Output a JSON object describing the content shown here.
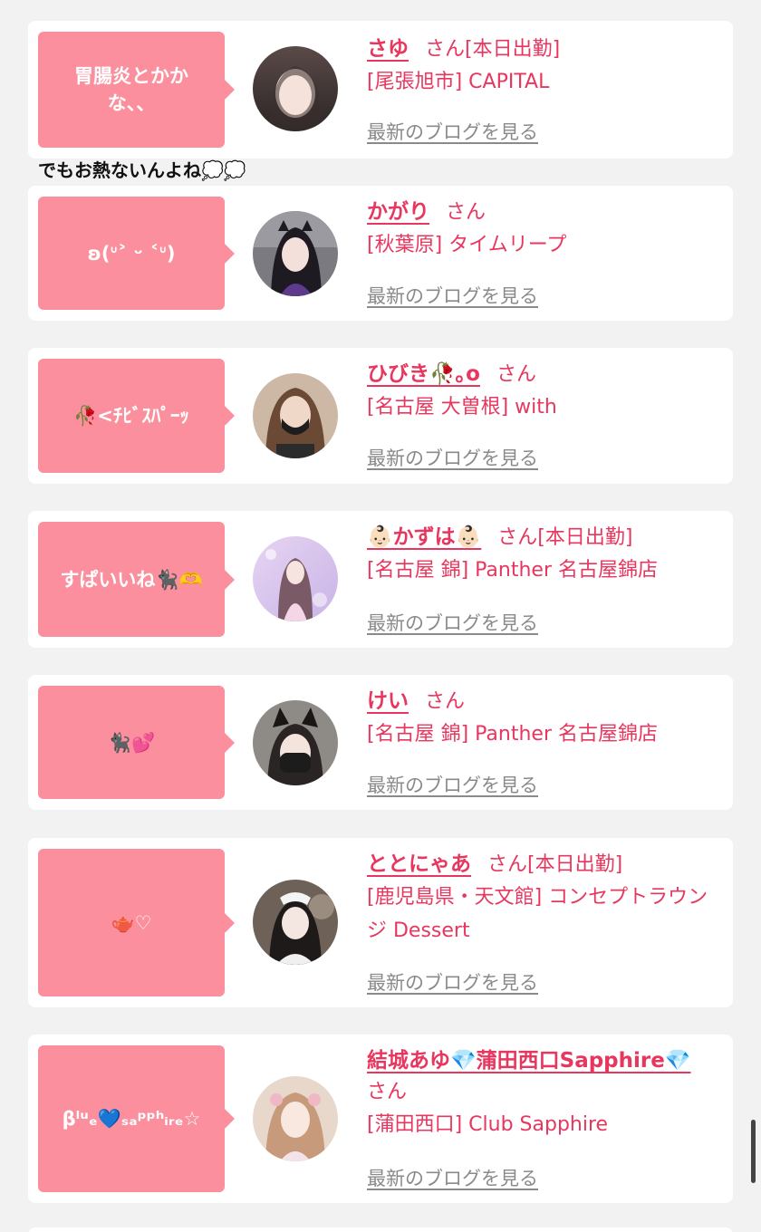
{
  "common": {
    "san": "さん",
    "blog_link": "最新のブログを見る"
  },
  "colors": {
    "page_bg": "#f2f2f2",
    "card_bg": "#ffffff",
    "bubble_bg": "#fb8f9d",
    "accent": "#e8375f",
    "link_gray": "#8a8a8a"
  },
  "overflow_text": "でもお熱ないんよね💭💭",
  "cards": [
    {
      "bubble": "胃腸炎とかかな、、",
      "name": "さゆ",
      "flag": "[本日出勤]",
      "shop": "[尾張旭市] CAPITAL"
    },
    {
      "bubble": "ʚ(ᐡ˃ ᵕ ˂ᐡ)",
      "name": "かがり",
      "flag": "",
      "shop": "[秋葉原] タイムリープ"
    },
    {
      "bubble": "🥀<ﾁﾋﾞｽﾊﾟｰｯ",
      "name": "ひびき🥀｡o",
      "flag": "",
      "shop": "[名古屋 大曽根] with"
    },
    {
      "bubble": "すぱいいね🐈‍⬛🫶",
      "name": "👶🏻かずは👶🏻",
      "flag": "[本日出勤]",
      "shop": "[名古屋 錦] Panther 名古屋錦店"
    },
    {
      "bubble": "🐈‍⬛💕",
      "name": "けい",
      "flag": "",
      "shop": "[名古屋 錦] Panther 名古屋錦店"
    },
    {
      "bubble": "🫖♡",
      "name": "ととにゃあ",
      "flag": "[本日出勤]",
      "shop": "[鹿児島県・天文館] コンセプトラウンジ Dessert"
    },
    {
      "bubble": "βˡᵘₑ💙ₛₐᵖᵖʰᵢᵣₑ☆",
      "name": "結城あゆ💎蒲田西口Sapphire💎",
      "flag": "",
      "shop": "[蒲田西口] Club Sapphire"
    }
  ]
}
